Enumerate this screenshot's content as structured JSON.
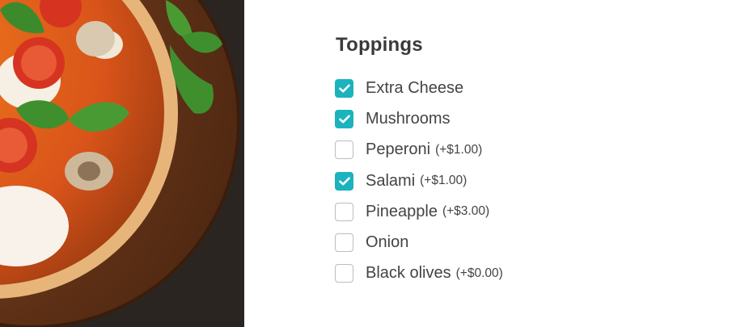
{
  "toppings": {
    "title": "Toppings",
    "options": [
      {
        "label": "Extra Cheese",
        "price": "",
        "checked": true
      },
      {
        "label": "Mushrooms",
        "price": "",
        "checked": true
      },
      {
        "label": "Peperoni",
        "price": "(+$1.00)",
        "checked": false
      },
      {
        "label": "Salami",
        "price": "(+$1.00)",
        "checked": true
      },
      {
        "label": "Pineapple",
        "price": "(+$3.00)",
        "checked": false
      },
      {
        "label": "Onion",
        "price": "",
        "checked": false
      },
      {
        "label": "Black olives",
        "price": "(+$0.00)",
        "checked": false
      }
    ]
  },
  "colors": {
    "accent": "#1bb3bd",
    "text": "#444444"
  },
  "icons": {
    "check": "checkmark-icon"
  }
}
